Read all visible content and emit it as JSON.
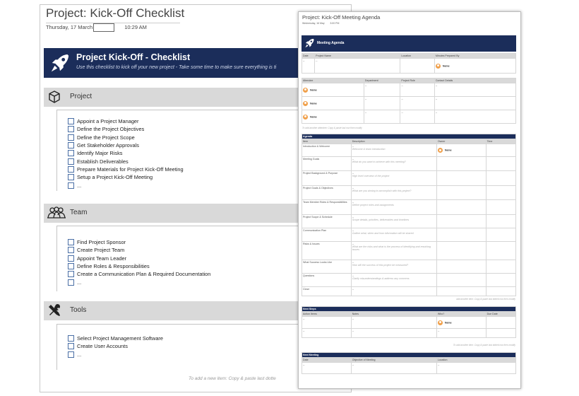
{
  "checklist": {
    "title": "Project: Kick-Off Checklist",
    "date": "Thursday, 17 March",
    "time": "10:29 AM",
    "hero_title": "Project Kick-Off - Checklist",
    "hero_subtitle": "Use this checklist to kick off your new project - Take some time to make sure everything is ti",
    "sections": [
      {
        "label": "Project",
        "icon": "cube-icon",
        "items": [
          "Appoint a Project Manager",
          "Define the Project Objectives",
          "Define the Project Scope",
          "Get Stakeholder Approvals",
          "Identify Major Risks",
          "Establish Deliverables",
          "Prepare Materials for Project Kick-Off Meeting",
          "Setup a Project Kick-Off Meeting",
          "..."
        ]
      },
      {
        "label": "Team",
        "icon": "team-icon",
        "items": [
          "Find Project Sponsor",
          "Create Project Team",
          "Appoint Team Leader",
          "Define Roles & Responsibilities",
          "Create a Communication Plan & Required Documentation",
          "..."
        ]
      },
      {
        "label": "Tools",
        "icon": "tools-icon",
        "items": [
          "Select Project Management Software",
          "Create User Accounts",
          "..."
        ]
      }
    ],
    "footer": "To add a new item: Copy & paste last dotte"
  },
  "agenda": {
    "title": "Project: Kick-Off Meeting Agenda",
    "date": "Wednesday, 16 May",
    "time": "3:00 PM",
    "hero_title": "Meeting Agenda",
    "header_cols": [
      "Date",
      "Project Name",
      "Location",
      "Minutes Prepared By"
    ],
    "header_vals": [
      "--",
      "--",
      "",
      ""
    ],
    "name_label": "Name",
    "attendee_cols": [
      "Attendee",
      "Department",
      "Project Role",
      "Contact Details"
    ],
    "attendee_note": "To add another attendee: Copy & paste last row then modify",
    "agenda_title": "Agenda",
    "agenda_cols": [
      "Item",
      "Description",
      "Owner",
      "Time"
    ],
    "agenda_rows": [
      {
        "item": "Introduction & Welcome",
        "desc": "Welcome & team introduction"
      },
      {
        "item": "Meeting Goals",
        "desc": "What do you want to achieve with this meeting?"
      },
      {
        "item": "Project Background & Purpose",
        "desc": "High level overview of the project"
      },
      {
        "item": "Project Goals & Objectives",
        "desc": "What are you aiming to accomplish with this project?"
      },
      {
        "item": "Team Member Roles & Responsibilities",
        "desc": "Define project roles and assignments"
      },
      {
        "item": "Project Scope & Schedule",
        "desc": "Scope details, priorities, deliverables and timelines"
      },
      {
        "item": "Communication Plan",
        "desc": "Outline what, when and how information will be shared"
      },
      {
        "item": "Risks & Issues",
        "desc": "What are the risks and what is the process of identifying and resolving issues"
      },
      {
        "item": "What Success Looks Like",
        "desc": "How will the success of this project be measured?"
      },
      {
        "item": "Questions",
        "desc": "Clarify misunderstandings & address any concerns"
      },
      {
        "item": "Close",
        "desc": ""
      }
    ],
    "agenda_note": "add another item: Copy & paste last dotted row then modify",
    "next_steps_title": "Next Steps",
    "next_steps_cols": [
      "Action Items",
      "Notes",
      "Who?",
      "Due Date"
    ],
    "next_steps_note": "To add another item: Copy & paste last dotted row then modify",
    "next_meeting_title": "Next Meeting",
    "next_meeting_cols": [
      "Date",
      "Objective of Meeting",
      "Location"
    ],
    "dash": "--"
  }
}
